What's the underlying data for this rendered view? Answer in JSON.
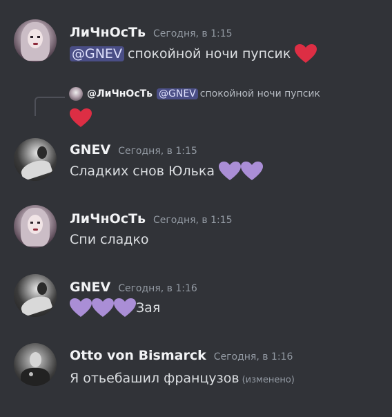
{
  "messages": [
    {
      "author": "ЛиЧнОсТь",
      "time": "Сегодня, в 1:15",
      "mention": "@GNEV",
      "text": "спокойной ночи пупсик",
      "emoji": "red-heart"
    },
    {
      "reply": {
        "author": "@ЛиЧнОсТь",
        "mention": "@GNEV",
        "text": "спокойной ночи пупсик",
        "emoji": "red-heart"
      },
      "author": "GNEV",
      "time": "Сегодня, в 1:15",
      "text": "Сладких снов Юлька",
      "emoji": "purple-heart x2"
    },
    {
      "author": "ЛиЧнОсТь",
      "time": "Сегодня, в 1:15",
      "text": "Спи сладко"
    },
    {
      "author": "GNEV",
      "time": "Сегодня, в 1:16",
      "emoji": "purple-heart x3",
      "text": "Зая"
    },
    {
      "author": "Otto von Bismarck",
      "time": "Сегодня, в 1:16",
      "text": "Я отьебашил французов",
      "edited": "(изменено)"
    }
  ],
  "colors": {
    "background": "#313338",
    "mention_bg": "#4a4e86",
    "red_heart": "#dd2e44",
    "purple_heart": "#aa8ed6"
  }
}
